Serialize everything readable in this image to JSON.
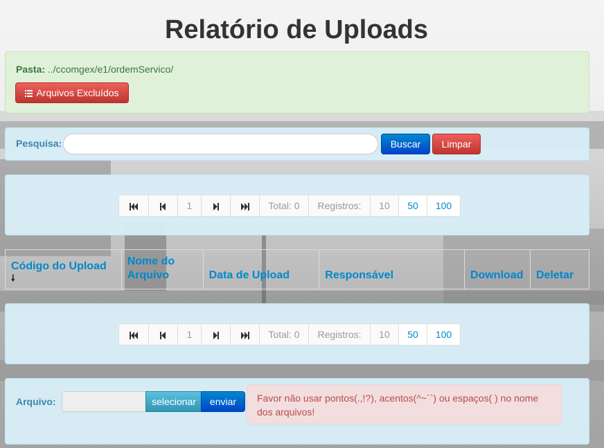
{
  "page": {
    "title": "Relatório de Uploads"
  },
  "folder": {
    "label": "Pasta:",
    "path": "../ccomgex/e1/ordemServico/",
    "deleted_files_button": "Arquivos Excluídos"
  },
  "search": {
    "label": "Pesquisa:",
    "value": "",
    "placeholder": "",
    "search_button": "Buscar",
    "clear_button": "Limpar"
  },
  "pagination": {
    "current_page": "1",
    "total_label": "Total: 0",
    "records_label": "Registros:",
    "page_size_options": [
      "10",
      "50",
      "100"
    ],
    "selected_page_size": "10",
    "icons": [
      "first-page-icon",
      "previous-page-icon",
      "next-page-icon",
      "last-page-icon"
    ]
  },
  "table": {
    "columns": [
      "Código do Upload",
      "Nome do Arquivo",
      "Data de Upload",
      "Responsável",
      "Download",
      "Deletar"
    ],
    "sort_icon": "arrow-down-icon",
    "rows": []
  },
  "upload": {
    "label": "Arquivo:",
    "file_value": "",
    "select_button": "selecionar",
    "send_button": "enviar",
    "warning": "Favor não usar pontos(.,!?), acentos(^~´`) ou espaços( ) no nome dos arquivos!"
  },
  "colors": {
    "success_bg": "#dff0d8",
    "info_bg": "#d9edf7",
    "link": "#0088cc",
    "danger": "#bd362f",
    "primary": "#0044cc",
    "error_bg": "#f2dede"
  }
}
